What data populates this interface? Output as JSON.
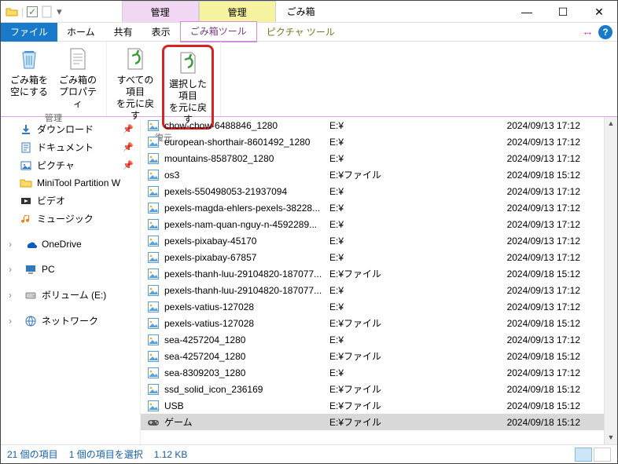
{
  "title": "ごみ箱",
  "context_tabs": [
    {
      "label": "管理",
      "cls": "ctx-purple"
    },
    {
      "label": "管理",
      "cls": "ctx-yellow"
    }
  ],
  "tabs": {
    "file": "ファイル",
    "home": "ホーム",
    "share": "共有",
    "view": "表示",
    "recycle_tools": "ごみ箱ツール",
    "picture_tools": "ピクチャ ツール"
  },
  "ribbon": {
    "empty": {
      "l1": "ごみ箱を",
      "l2": "空にする"
    },
    "props": {
      "l1": "ごみ箱の",
      "l2": "プロパティ"
    },
    "restore_all": {
      "l1": "すべての項目",
      "l2": "を元に戻す"
    },
    "restore_sel": {
      "l1": "選択した項目",
      "l2": "を元に戻す"
    },
    "group_manage": "管理",
    "group_restore": "復元"
  },
  "nav": [
    {
      "label": "ダウンロード",
      "icon": "dl",
      "pin": true
    },
    {
      "label": "ドキュメント",
      "icon": "doc",
      "pin": true
    },
    {
      "label": "ピクチャ",
      "icon": "pic",
      "pin": true
    },
    {
      "label": "MiniTool Partition W",
      "icon": "fld"
    },
    {
      "label": "ビデオ",
      "icon": "vid"
    },
    {
      "label": "ミュージック",
      "icon": "mus"
    }
  ],
  "nav2": [
    {
      "label": "OneDrive",
      "icon": "od"
    }
  ],
  "nav3": [
    {
      "label": "PC",
      "icon": "pc"
    }
  ],
  "nav4": [
    {
      "label": "ボリューム (E:)",
      "icon": "drv"
    }
  ],
  "nav5": [
    {
      "label": "ネットワーク",
      "icon": "net"
    }
  ],
  "files": [
    {
      "name": "chow-chow-6488846_1280",
      "loc": "E:¥",
      "date": "2024/09/13 17:12",
      "icon": "img"
    },
    {
      "name": "european-shorthair-8601492_1280",
      "loc": "E:¥",
      "date": "2024/09/13 17:12",
      "icon": "img"
    },
    {
      "name": "mountains-8587802_1280",
      "loc": "E:¥",
      "date": "2024/09/13 17:12",
      "icon": "img"
    },
    {
      "name": "os3",
      "loc": "E:¥ファイル",
      "date": "2024/09/18 15:12",
      "icon": "img"
    },
    {
      "name": "pexels-550498053-21937094",
      "loc": "E:¥",
      "date": "2024/09/13 17:12",
      "icon": "img"
    },
    {
      "name": "pexels-magda-ehlers-pexels-38228...",
      "loc": "E:¥",
      "date": "2024/09/13 17:12",
      "icon": "img"
    },
    {
      "name": "pexels-nam-quan-nguy-n-4592289...",
      "loc": "E:¥",
      "date": "2024/09/13 17:12",
      "icon": "img"
    },
    {
      "name": "pexels-pixabay-45170",
      "loc": "E:¥",
      "date": "2024/09/13 17:12",
      "icon": "img"
    },
    {
      "name": "pexels-pixabay-67857",
      "loc": "E:¥",
      "date": "2024/09/13 17:12",
      "icon": "img"
    },
    {
      "name": "pexels-thanh-luu-29104820-187077...",
      "loc": "E:¥ファイル",
      "date": "2024/09/18 15:12",
      "icon": "img"
    },
    {
      "name": "pexels-thanh-luu-29104820-187077...",
      "loc": "E:¥",
      "date": "2024/09/13 17:12",
      "icon": "img"
    },
    {
      "name": "pexels-vatius-127028",
      "loc": "E:¥",
      "date": "2024/09/13 17:12",
      "icon": "img"
    },
    {
      "name": "pexels-vatius-127028",
      "loc": "E:¥ファイル",
      "date": "2024/09/18 15:12",
      "icon": "img"
    },
    {
      "name": "sea-4257204_1280",
      "loc": "E:¥",
      "date": "2024/09/13 17:12",
      "icon": "img"
    },
    {
      "name": "sea-4257204_1280",
      "loc": "E:¥ファイル",
      "date": "2024/09/18 15:12",
      "icon": "img"
    },
    {
      "name": "sea-8309203_1280",
      "loc": "E:¥",
      "date": "2024/09/13 17:12",
      "icon": "img"
    },
    {
      "name": "ssd_solid_icon_236169",
      "loc": "E:¥ファイル",
      "date": "2024/09/18 15:12",
      "icon": "img"
    },
    {
      "name": "USB",
      "loc": "E:¥ファイル",
      "date": "2024/09/18 15:12",
      "icon": "img"
    },
    {
      "name": "ゲーム",
      "loc": "E:¥ファイル",
      "date": "2024/09/18 15:12",
      "icon": "game",
      "sel": true
    }
  ],
  "status": {
    "count": "21 個の項目",
    "selection": "1 個の項目を選択",
    "size": "1.12 KB"
  }
}
